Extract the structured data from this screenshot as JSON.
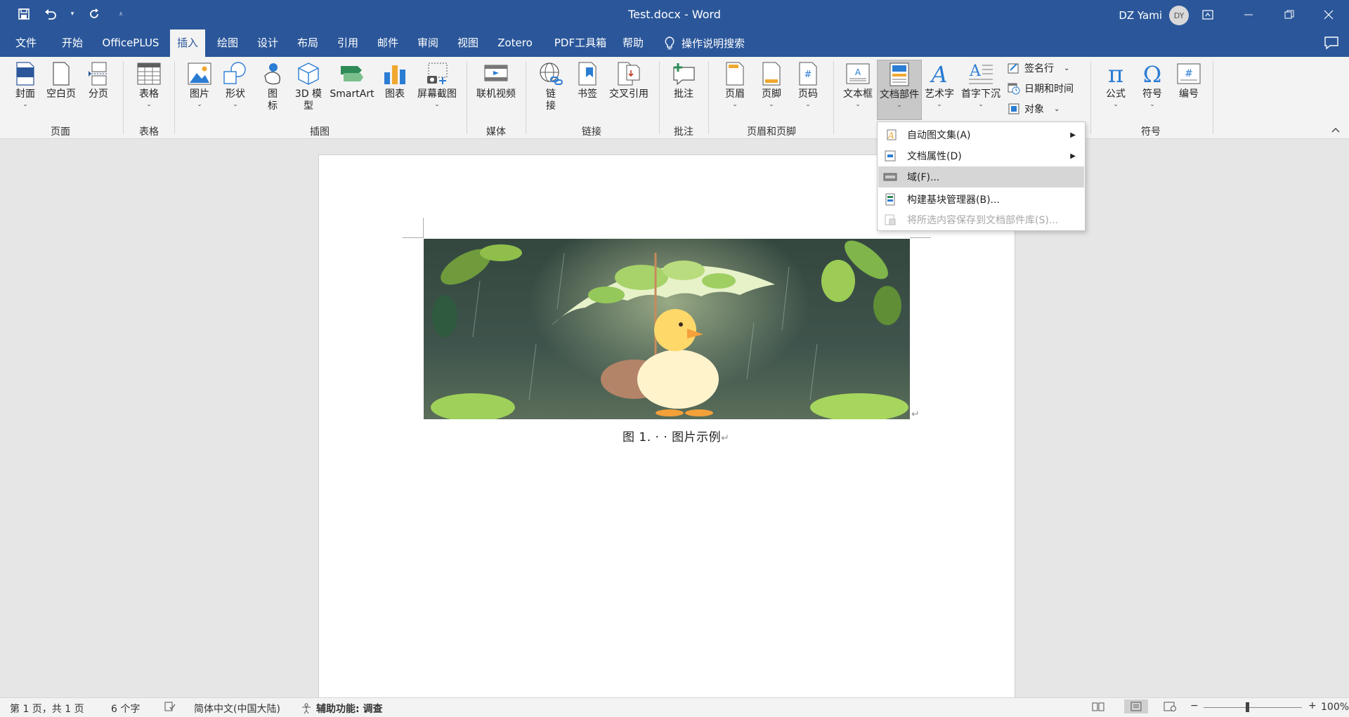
{
  "window": {
    "title": "Test.docx  -  Word",
    "user_name": "DZ Yami",
    "avatar_initials": "DY"
  },
  "tabs": [
    "文件",
    "开始",
    "OfficePLUS",
    "插入",
    "绘图",
    "设计",
    "布局",
    "引用",
    "邮件",
    "审阅",
    "视图",
    "Zotero",
    "PDF工具箱",
    "帮助"
  ],
  "active_tab": "插入",
  "tell_me": "操作说明搜索",
  "ribbon": {
    "cover": "封面",
    "blank_page": "空白页",
    "page_break": "分页",
    "table": "表格",
    "pictures": "图片",
    "shapes": "形状",
    "icons_l1": "图",
    "icons_l2": "标",
    "model3d_l1": "3D 模",
    "model3d_l2": "型",
    "smartart": "SmartArt",
    "chart": "图表",
    "screenshot": "屏幕截图",
    "online_video": "联机视频",
    "link_l1": "链",
    "link_l2": "接",
    "bookmark": "书签",
    "cross_ref": "交叉引用",
    "comment": "批注",
    "header": "页眉",
    "footer": "页脚",
    "page_number": "页码",
    "textbox": "文本框",
    "quick_parts": "文档部件",
    "wordart": "艺术字",
    "dropcap": "首字下沉",
    "signature": "签名行",
    "datetime": "日期和时间",
    "object": "对象",
    "equation": "公式",
    "symbol": "符号",
    "numbering": "编号",
    "groups": {
      "pages": "页面",
      "tables": "表格",
      "illustrations": "插图",
      "media": "媒体",
      "links": "链接",
      "comments": "批注",
      "header_footer": "页眉和页脚",
      "symbols": "符号"
    }
  },
  "quick_parts_menu": [
    {
      "label": "自动图文集(A)",
      "submenu": true
    },
    {
      "label": "文档属性(D)",
      "submenu": true
    },
    {
      "label": "域(F)...",
      "submenu": false
    },
    {
      "label": "构建基块管理器(B)...",
      "submenu": false
    },
    {
      "label": "将所选内容保存到文档部件库(S)...",
      "submenu": false
    }
  ],
  "document": {
    "caption": "图 1. · · 图片示例"
  },
  "status": {
    "page": "第 1 页，共 1 页",
    "words": "6 个字",
    "language": "简体中文(中国大陆)",
    "accessibility": "辅助功能: 调查",
    "zoom": "100%"
  },
  "colors": {
    "brand": "#2b579a",
    "ribbon_bg": "#f3f3f3",
    "canvas_bg": "#e6e6e6"
  }
}
